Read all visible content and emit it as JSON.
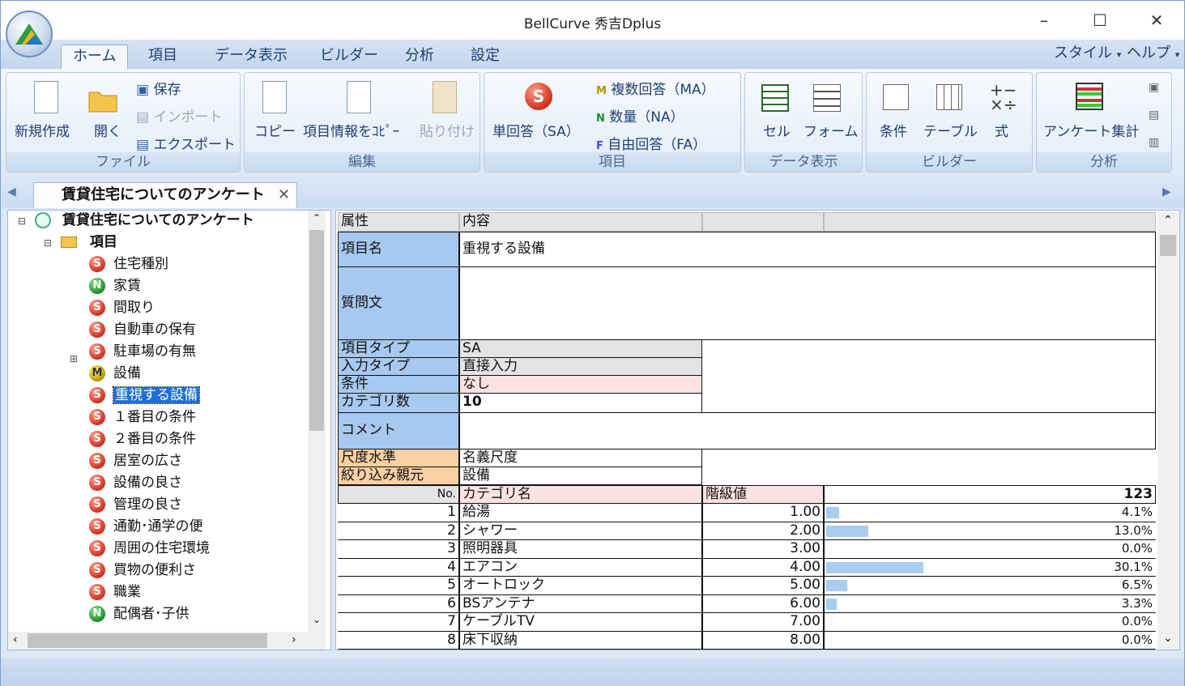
{
  "window": {
    "title": "BellCurve 秀吉Dplus"
  },
  "menu": {
    "tabs": [
      "ホーム",
      "項目",
      "データ表示",
      "ビルダー",
      "分析",
      "設定"
    ],
    "style": "スタイル",
    "help": "ヘルプ"
  },
  "ribbon": {
    "file": {
      "title": "ファイル",
      "new": "新規作成",
      "open": "開く",
      "save": "保存",
      "import": "インポート",
      "export": "エクスポート"
    },
    "edit": {
      "title": "編集",
      "copy": "コピー",
      "copy_info": "項目情報をｺﾋﾟｰ",
      "paste": "貼り付け"
    },
    "item": {
      "title": "項目",
      "sa": "単回答（SA）",
      "ma": "複数回答（MA）",
      "na": "数量（NA）",
      "fa": "自由回答（FA）"
    },
    "data": {
      "title": "データ表示",
      "cell": "セル",
      "form": "フォーム"
    },
    "builder": {
      "title": "ビルダー",
      "cond": "条件",
      "table": "テーブル",
      "formula": "式"
    },
    "analysis": {
      "title": "分析",
      "survey": "アンケート集計"
    }
  },
  "doc_tab": "賃貸住宅についてのアンケート",
  "tree": {
    "root": "賃貸住宅についてのアンケート",
    "folder": "項目",
    "items": [
      {
        "type": "S",
        "label": "住宅種別"
      },
      {
        "type": "N",
        "label": "家賃"
      },
      {
        "type": "S",
        "label": "間取り"
      },
      {
        "type": "S",
        "label": "自動車の保有"
      },
      {
        "type": "S",
        "label": "駐車場の有無"
      },
      {
        "type": "M",
        "label": "設備"
      },
      {
        "type": "S",
        "label": "重視する設備"
      },
      {
        "type": "S",
        "label": "１番目の条件"
      },
      {
        "type": "S",
        "label": "２番目の条件"
      },
      {
        "type": "S",
        "label": "居室の広さ"
      },
      {
        "type": "S",
        "label": "設備の良さ"
      },
      {
        "type": "S",
        "label": "管理の良さ"
      },
      {
        "type": "S",
        "label": "通勤･通学の便"
      },
      {
        "type": "S",
        "label": "周囲の住宅環境"
      },
      {
        "type": "S",
        "label": "買物の便利さ"
      },
      {
        "type": "S",
        "label": "職業"
      },
      {
        "type": "N",
        "label": "配偶者･子供"
      }
    ],
    "selected": 6
  },
  "detail": {
    "h_attr": "属性",
    "h_content": "内容",
    "name_l": "項目名",
    "name_v": "重視する設備",
    "q_l": "質問文",
    "q_v": "",
    "type_l": "項目タイプ",
    "type_v": "SA",
    "input_l": "入力タイプ",
    "input_v": "直接入力",
    "cond_l": "条件",
    "cond_v": "なし",
    "cnt_l": "カテゴリ数",
    "cnt_v": "10",
    "comment_l": "コメント",
    "comment_v": "",
    "scale_l": "尺度水準",
    "scale_v": "名義尺度",
    "parent_l": "絞り込み親元",
    "parent_v": "設備",
    "col_no": "No.",
    "col_cat": "カテゴリ名",
    "col_val": "階級値",
    "total": "123",
    "cats": [
      {
        "no": "1",
        "name": "給湯",
        "val": "1.00",
        "pct": "4.1%",
        "p": 4.1
      },
      {
        "no": "2",
        "name": "シャワー",
        "val": "2.00",
        "pct": "13.0%",
        "p": 13.0
      },
      {
        "no": "3",
        "name": "照明器具",
        "val": "3.00",
        "pct": "0.0%",
        "p": 0
      },
      {
        "no": "4",
        "name": "エアコン",
        "val": "4.00",
        "pct": "30.1%",
        "p": 30.1
      },
      {
        "no": "5",
        "name": "オートロック",
        "val": "5.00",
        "pct": "6.5%",
        "p": 6.5
      },
      {
        "no": "6",
        "name": "BSアンテナ",
        "val": "6.00",
        "pct": "3.3%",
        "p": 3.3
      },
      {
        "no": "7",
        "name": "ケーブルTV",
        "val": "7.00",
        "pct": "0.0%",
        "p": 0
      },
      {
        "no": "8",
        "name": "床下収納",
        "val": "8.00",
        "pct": "0.0%",
        "p": 0
      }
    ]
  }
}
